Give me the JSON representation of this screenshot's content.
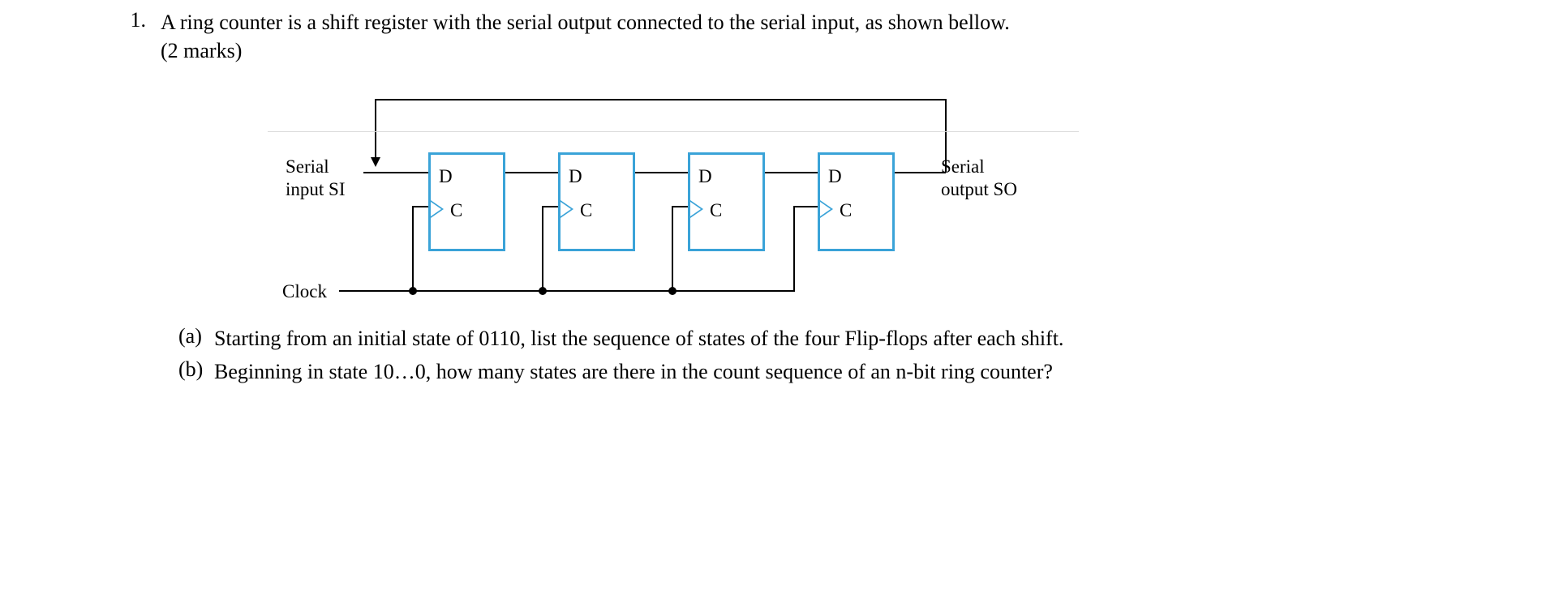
{
  "question": {
    "number": "1.",
    "text_line1": "A ring counter is a shift register with the serial output connected to the serial input, as shown bellow.",
    "text_line2": "(2 marks)"
  },
  "diagram": {
    "serial_input_label": "Serial",
    "serial_input_label2": "input SI",
    "serial_output_label": "Serial",
    "serial_output_label2": "output SO",
    "clock_label": "Clock",
    "ff": [
      {
        "D": "D",
        "C": "C"
      },
      {
        "D": "D",
        "C": "C"
      },
      {
        "D": "D",
        "C": "C"
      },
      {
        "D": "D",
        "C": "C"
      }
    ]
  },
  "subparts": {
    "a_label": "(a)",
    "a_text": "Starting from an initial state of 0110, list the sequence of states of the four Flip-flops after each shift.",
    "b_label": "(b)",
    "b_text": "Beginning in state 10…0, how many states are there in the count sequence of an n-bit ring counter?"
  }
}
